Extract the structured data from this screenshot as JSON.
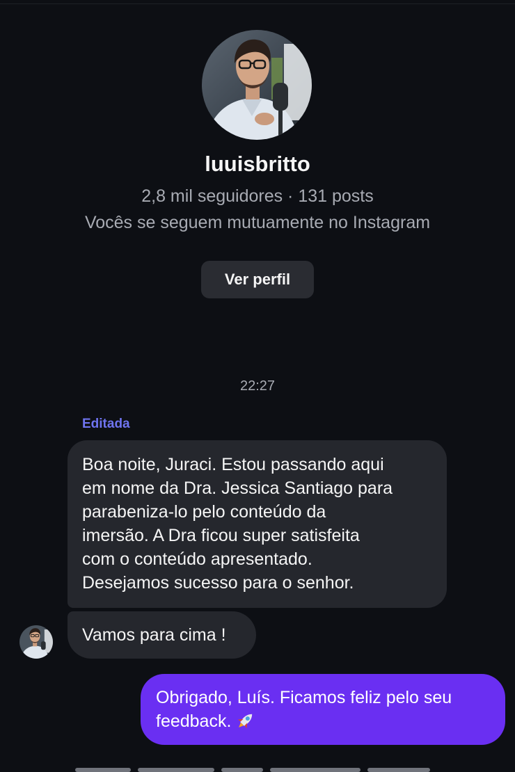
{
  "profile": {
    "username": "luuisbritto",
    "stats": "2,8 mil seguidores · 131 posts",
    "mutual": "Vocês se seguem mutuamente no Instagram",
    "view_profile_label": "Ver perfil"
  },
  "chat": {
    "timestamp": "22:27",
    "edited_label": "Editada",
    "incoming": {
      "message_1_lines": [
        "Boa noite, Juraci. Estou passando aqui",
        "em nome da Dra. Jessica Santiago para",
        "parabeniza-lo pelo conteúdo da",
        "imersão. A Dra ficou super satisfeita",
        "com o conteúdo apresentado.",
        "Desejamos sucesso para o senhor."
      ],
      "message_2": "Vamos para cima !"
    },
    "outgoing": {
      "message_lines": [
        "Obrigado, Luís. Ficamos feliz pelo seu",
        "feedback."
      ],
      "emoji_icon": "rocket-icon"
    }
  },
  "colors": {
    "background": "#0d0f14",
    "incoming_bubble": "#25272d",
    "outgoing_bubble": "#6a2ff2",
    "edited_label": "#6f74f0",
    "secondary_text": "#a8abb3"
  }
}
